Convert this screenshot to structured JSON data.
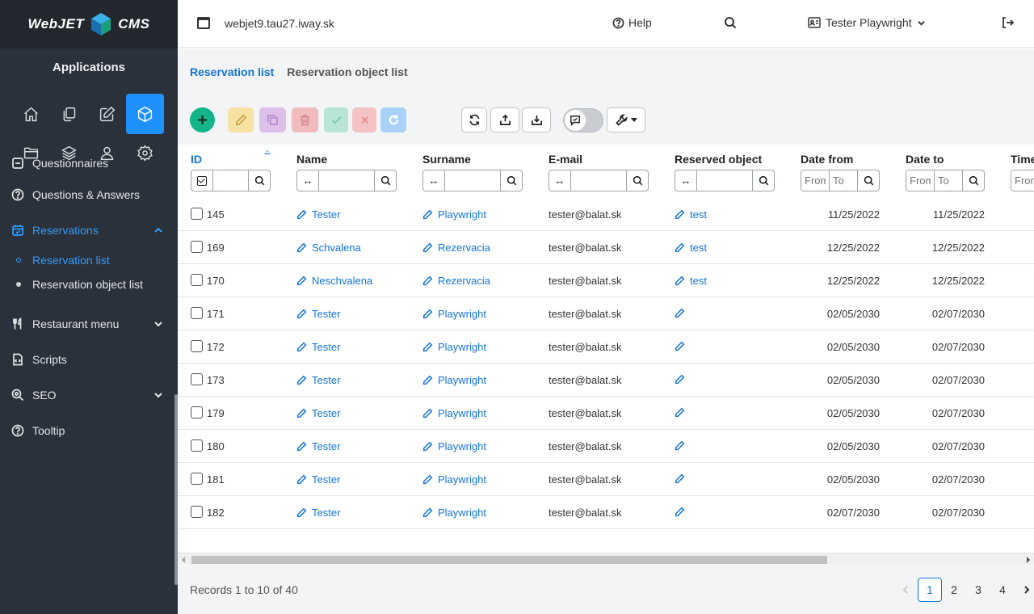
{
  "sidebar": {
    "logo_left": "WebJET",
    "logo_right": "CMS",
    "apps_title": "Applications",
    "row1_icons": [
      "home-icon",
      "copy-icon",
      "edit-icon",
      "box-icon"
    ],
    "row2_icons": [
      "folder-icon",
      "layers-icon",
      "user-icon",
      "gear-icon"
    ],
    "menu": [
      {
        "label": "Questionnaires",
        "icon": "questionnaire-icon"
      },
      {
        "label": "Questions & Answers",
        "icon": "question-circle-icon"
      },
      {
        "label": "Reservations",
        "icon": "calendar-icon",
        "open": true
      },
      {
        "label": "Reservation list",
        "sub": true,
        "active": true
      },
      {
        "label": "Reservation object list",
        "sub": true
      },
      {
        "label": "Restaurant menu",
        "icon": "utensils-icon"
      },
      {
        "label": "Scripts",
        "icon": "script-icon"
      },
      {
        "label": "SEO",
        "icon": "seo-icon"
      },
      {
        "label": "Tooltip",
        "icon": "question-circle-icon"
      }
    ]
  },
  "topbar": {
    "domain": "webjet9.tau27.iway.sk",
    "help": "Help",
    "user": "Tester Playwright"
  },
  "tabs": [
    {
      "label": "Reservation list",
      "active": true
    },
    {
      "label": "Reservation object list",
      "active": false
    }
  ],
  "table": {
    "columns": {
      "id": "ID",
      "name": "Name",
      "surname": "Surname",
      "email": "E-mail",
      "object": "Reserved object",
      "date_from": "Date from",
      "date_to": "Date to",
      "time": "Time"
    },
    "filters": {
      "from_placeholder": "From",
      "to_placeholder": "To"
    },
    "rows": [
      {
        "id": "145",
        "name": "Tester",
        "surname": "Playwright",
        "email": "tester@balat.sk",
        "object": "test",
        "from": "11/25/2022",
        "to": "11/25/2022"
      },
      {
        "id": "169",
        "name": "Schvalena",
        "surname": "Rezervacia",
        "email": "tester@balat.sk",
        "object": "test",
        "from": "12/25/2022",
        "to": "12/25/2022"
      },
      {
        "id": "170",
        "name": "Neschvalena",
        "surname": "Rezervacia",
        "email": "tester@balat.sk",
        "object": "test",
        "from": "12/25/2022",
        "to": "12/25/2022"
      },
      {
        "id": "171",
        "name": "Tester",
        "surname": "Playwright",
        "email": "tester@balat.sk",
        "object": "",
        "from": "02/05/2030",
        "to": "02/07/2030"
      },
      {
        "id": "172",
        "name": "Tester",
        "surname": "Playwright",
        "email": "tester@balat.sk",
        "object": "",
        "from": "02/05/2030",
        "to": "02/07/2030"
      },
      {
        "id": "173",
        "name": "Tester",
        "surname": "Playwright",
        "email": "tester@balat.sk",
        "object": "",
        "from": "02/05/2030",
        "to": "02/07/2030"
      },
      {
        "id": "179",
        "name": "Tester",
        "surname": "Playwright",
        "email": "tester@balat.sk",
        "object": "",
        "from": "02/05/2030",
        "to": "02/07/2030"
      },
      {
        "id": "180",
        "name": "Tester",
        "surname": "Playwright",
        "email": "tester@balat.sk",
        "object": "",
        "from": "02/05/2030",
        "to": "02/07/2030"
      },
      {
        "id": "181",
        "name": "Tester",
        "surname": "Playwright",
        "email": "tester@balat.sk",
        "object": "",
        "from": "02/05/2030",
        "to": "02/07/2030"
      },
      {
        "id": "182",
        "name": "Tester",
        "surname": "Playwright",
        "email": "tester@balat.sk",
        "object": "",
        "from": "02/07/2030",
        "to": "02/07/2030"
      }
    ]
  },
  "footer": {
    "records": "Records 1 to 10 of 40",
    "pages": [
      "1",
      "2",
      "3",
      "4"
    ],
    "current_page": "1"
  },
  "colors": {
    "accent": "#1474d8",
    "sidebar_bg": "#2b313a",
    "add_button": "#12b489"
  }
}
